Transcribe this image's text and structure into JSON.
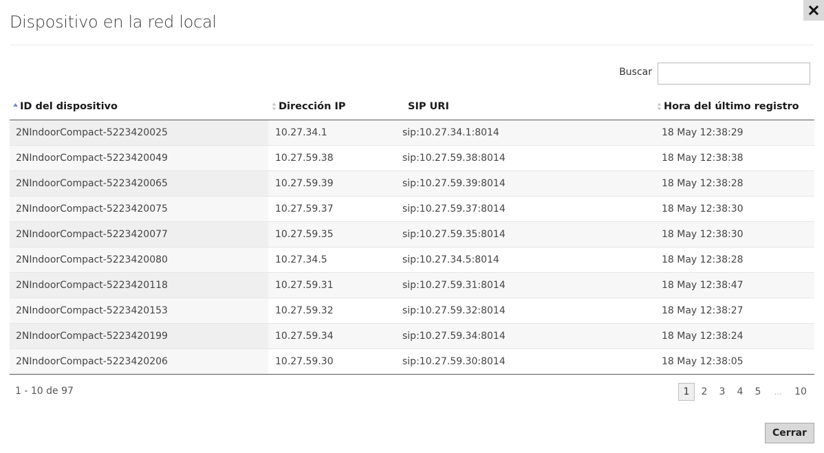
{
  "dialog": {
    "title": "Dispositivo en la red local",
    "close_icon": "close-icon"
  },
  "search": {
    "label": "Buscar",
    "value": "",
    "placeholder": ""
  },
  "table": {
    "columns": [
      {
        "label": "ID del dispositivo",
        "sort": "ascending"
      },
      {
        "label": "Dirección IP",
        "sort": "sortable"
      },
      {
        "label": "SIP URI",
        "sort": "none"
      },
      {
        "label": "Hora del último registro",
        "sort": "sortable"
      }
    ],
    "rows": [
      [
        "2NIndoorCompact-5223420025",
        "10.27.34.1",
        "sip:10.27.34.1:8014",
        "18 May 12:38:29"
      ],
      [
        "2NIndoorCompact-5223420049",
        "10.27.59.38",
        "sip:10.27.59.38:8014",
        "18 May 12:38:38"
      ],
      [
        "2NIndoorCompact-5223420065",
        "10.27.59.39",
        "sip:10.27.59.39:8014",
        "18 May 12:38:28"
      ],
      [
        "2NIndoorCompact-5223420075",
        "10.27.59.37",
        "sip:10.27.59.37:8014",
        "18 May 12:38:30"
      ],
      [
        "2NIndoorCompact-5223420077",
        "10.27.59.35",
        "sip:10.27.59.35:8014",
        "18 May 12:38:30"
      ],
      [
        "2NIndoorCompact-5223420080",
        "10.27.34.5",
        "sip:10.27.34.5:8014",
        "18 May 12:38:28"
      ],
      [
        "2NIndoorCompact-5223420118",
        "10.27.59.31",
        "sip:10.27.59.31:8014",
        "18 May 12:38:47"
      ],
      [
        "2NIndoorCompact-5223420153",
        "10.27.59.32",
        "sip:10.27.59.32:8014",
        "18 May 12:38:27"
      ],
      [
        "2NIndoorCompact-5223420199",
        "10.27.59.34",
        "sip:10.27.59.34:8014",
        "18 May 12:38:24"
      ],
      [
        "2NIndoorCompact-5223420206",
        "10.27.59.30",
        "sip:10.27.59.30:8014",
        "18 May 12:38:05"
      ]
    ]
  },
  "footer": {
    "record_count": "1 - 10 de 97",
    "pagination": {
      "pages": [
        "1",
        "2",
        "3",
        "4",
        "5"
      ],
      "ellipsis": "...",
      "last": "10",
      "current": "1"
    },
    "close_label": "Cerrar"
  },
  "colors": {
    "sort_active": "#7a86c8",
    "sort_inactive": "#c8c8c8",
    "button_bg": "#d9d9d9"
  }
}
